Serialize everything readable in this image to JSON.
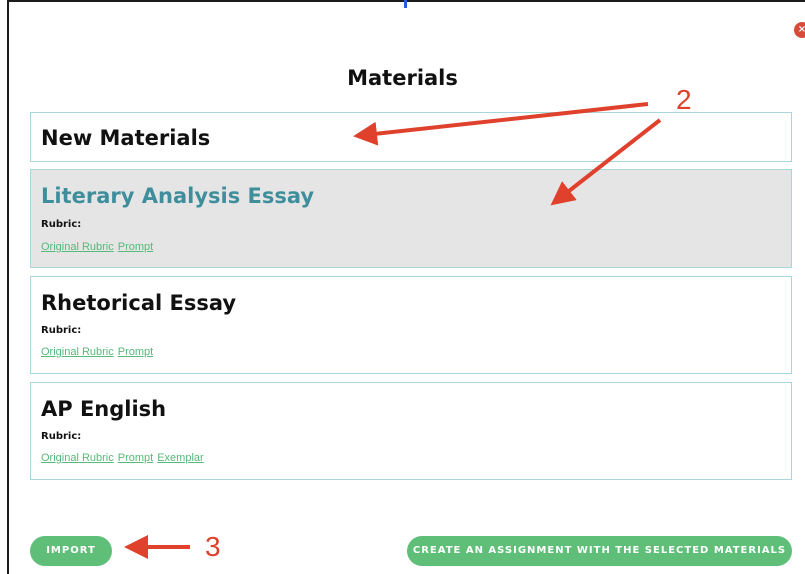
{
  "modal": {
    "title": "Materials",
    "close_icon": "close-icon",
    "cards": [
      {
        "title": "New Materials"
      },
      {
        "title": "Literary Analysis Essay",
        "rubric_label": "Rubric:",
        "links": [
          "Original Rubric",
          "Prompt"
        ],
        "selected": true
      },
      {
        "title": "Rhetorical Essay",
        "rubric_label": "Rubric:",
        "links": [
          "Original Rubric",
          "Prompt"
        ]
      },
      {
        "title": "AP English",
        "rubric_label": "Rubric:",
        "links": [
          "Original Rubric",
          "Prompt",
          "Exemplar"
        ]
      }
    ],
    "import_label": "IMPORT",
    "create_label": "CREATE AN ASSIGNMENT WITH THE SELECTED MATERIALS"
  },
  "annotations": {
    "step2": "2",
    "step3": "3"
  },
  "colors": {
    "accent_green": "#5fbf79",
    "selected_title": "#3f8e9c",
    "card_border": "#a9d6da",
    "annotation_red": "#e0412c"
  }
}
